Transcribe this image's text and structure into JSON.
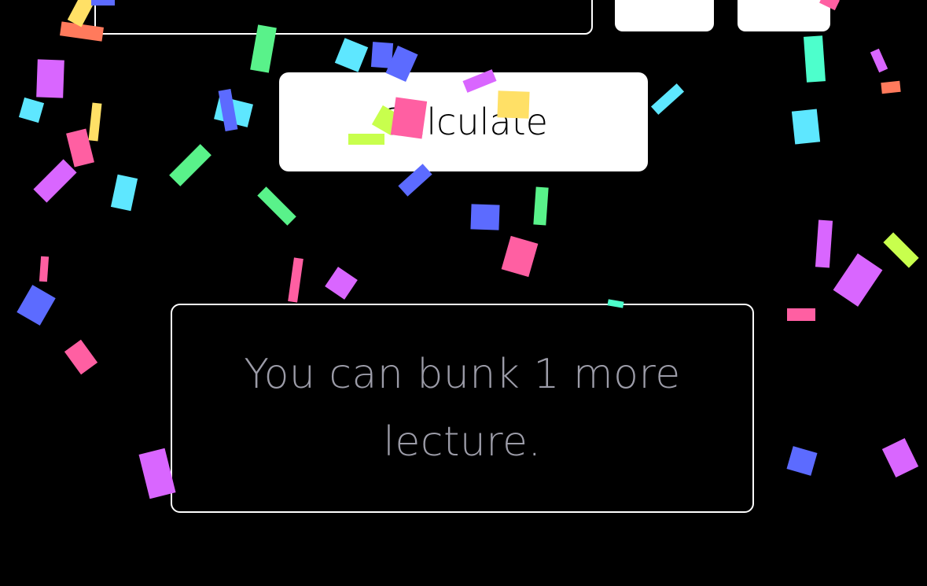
{
  "calculate_button": {
    "label": "Calculate"
  },
  "result": {
    "message": "You can bunk 1 more lecture."
  },
  "confetti": {
    "colors": [
      "#ff5fa2",
      "#d966ff",
      "#5c6bff",
      "#5ee7ff",
      "#59f28a",
      "#c8ff4d",
      "#ffe066",
      "#ff7a5c",
      "#4dffcc"
    ]
  }
}
